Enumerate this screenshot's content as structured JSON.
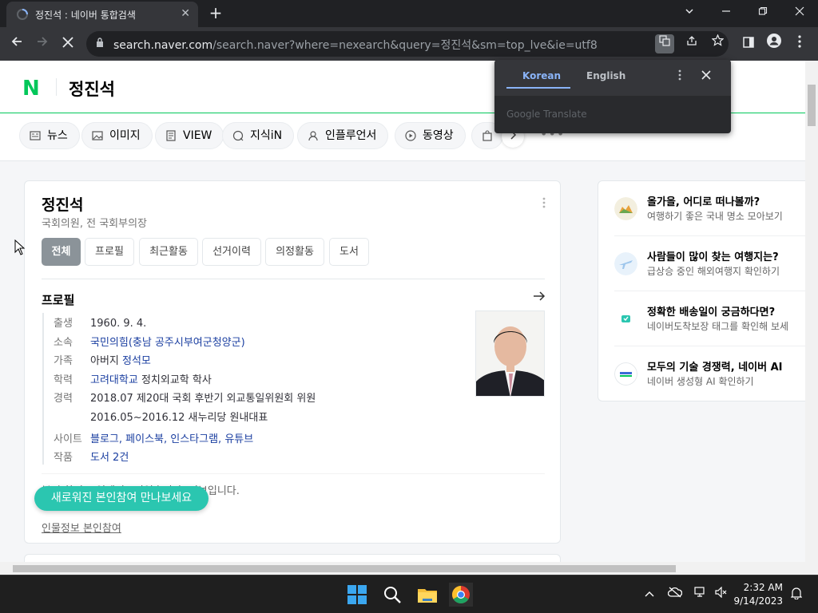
{
  "browser": {
    "tab_title": "정진석 : 네이버 통합검색",
    "tab_close": "✕",
    "new_tab": "+",
    "url_host": "search.naver.com",
    "url_path": "/search.naver?where=nexearch&query=정진석&sm=top_lve&ie=utf8"
  },
  "translate_popup": {
    "lang_source": "Korean",
    "lang_target": "English",
    "brand": "Google Translate"
  },
  "naver": {
    "logo": "N",
    "query": "정진석",
    "tabs": [
      "뉴스",
      "이미지",
      "VIEW",
      "지식iN",
      "인플루언서",
      "동영상"
    ],
    "more": "•••"
  },
  "profile_card": {
    "name": "정진석",
    "subtitle": "국회의원, 전 국회부의장",
    "tabs": [
      "전체",
      "프로필",
      "최근활동",
      "선거이력",
      "의정활동",
      "도서"
    ],
    "section_title": "프로필",
    "rows": [
      {
        "key": "출생",
        "value": "1960. 9. 4."
      },
      {
        "key": "소속",
        "value": "국민의힘(충남 공주시부여군청양군)"
      },
      {
        "key": "가족",
        "value_prefix": "아버지 ",
        "value_link": "정석모"
      },
      {
        "key": "학력",
        "value_link": "고려대학교",
        "value_suffix": " 정치외교학 학사"
      },
      {
        "key": "경력",
        "value": "2018.07 제20대 국회 후반기 외교통일위원회 위원"
      },
      {
        "key": "",
        "value": "2016.05~2016.12 새누리당 원내대표"
      },
      {
        "key": "사이트",
        "value": "블로그, 페이스북, 인스타그램, 유튜브"
      },
      {
        "key": "작품",
        "value": "도서 2건"
      }
    ],
    "footer_text": "본인 참여로 업데이트되었습니다. 정보입니다.",
    "footer_link": "인물정보 본인참여",
    "toast": "새로워진 본인참여 만나보세요"
  },
  "side_card": {
    "items": [
      {
        "title": "올가을, 어디로 떠나볼까?",
        "desc": "여행하기 좋은 국내 명소 모아보기"
      },
      {
        "title": "사람들이 많이 찾는 여행지는?",
        "desc": "급상승 중인 해외여행지 확인하기"
      },
      {
        "title": "정확한 배송일이 궁금하다면?",
        "desc": "네이버도착보장 태그를 확인해 보세"
      },
      {
        "title": "모두의 기술 경쟁력, 네이버 AI",
        "desc": "네이버 생성형 AI 확인하기"
      }
    ]
  },
  "taskbar": {
    "time": "2:32 AM",
    "date": "9/14/2023"
  },
  "colors": {
    "naver_green": "#03c75a",
    "link_blue": "#1a3ea0",
    "toast_teal": "#2bc6b0",
    "translate_blue": "#8ab4f8"
  }
}
